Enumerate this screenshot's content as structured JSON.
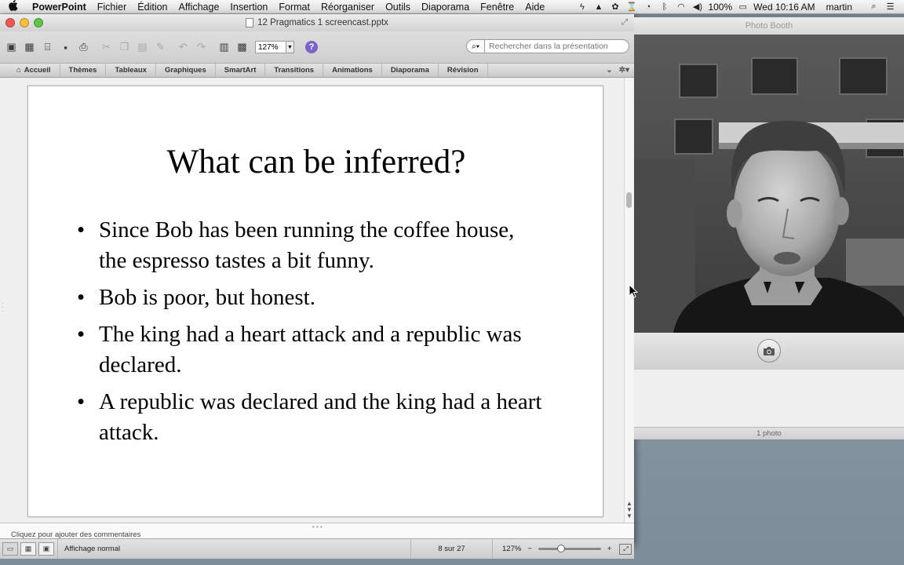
{
  "menubar": {
    "apple_icon": "apple-logo",
    "app_name": "PowerPoint",
    "items": [
      "Fichier",
      "Édition",
      "Affichage",
      "Insertion",
      "Format",
      "Réorganiser",
      "Outils",
      "Diaporama",
      "Fenêtre",
      "Aide"
    ],
    "battery": "100%",
    "clock": "Wed 10:16 AM",
    "user": "martin"
  },
  "powerpoint": {
    "window_title": "12 Pragmatics 1 screencast.pptx",
    "toolbar": {
      "zoom_value": "127%",
      "help_label": "?",
      "search_placeholder": "Rechercher dans la présentation"
    },
    "ribbon_tabs": [
      "Accueil",
      "Thèmes",
      "Tableaux",
      "Graphiques",
      "SmartArt",
      "Transitions",
      "Animations",
      "Diaporama",
      "Révision"
    ],
    "slide": {
      "title": "What can be inferred?",
      "bullet_symbol": "•",
      "bullets": [
        "Since Bob has been running the coffee house, the espresso tastes a bit funny.",
        "Bob is poor, but honest.",
        "The king had a heart attack and a republic was declared.",
        "A republic was declared and the king had a heart attack."
      ]
    },
    "notes_placeholder": "Cliquez pour ajouter des commentaires",
    "status": {
      "view_label": "Affichage normal",
      "slide_position": "8 sur 27",
      "zoom": "127%"
    }
  },
  "photobooth": {
    "window_title": "Photo Booth",
    "photo_count": "1 photo"
  },
  "colors": {
    "help_button": "#7b62c8",
    "close": "#ee5a52",
    "minimize": "#f5be3d",
    "maximize": "#5fc64a"
  }
}
